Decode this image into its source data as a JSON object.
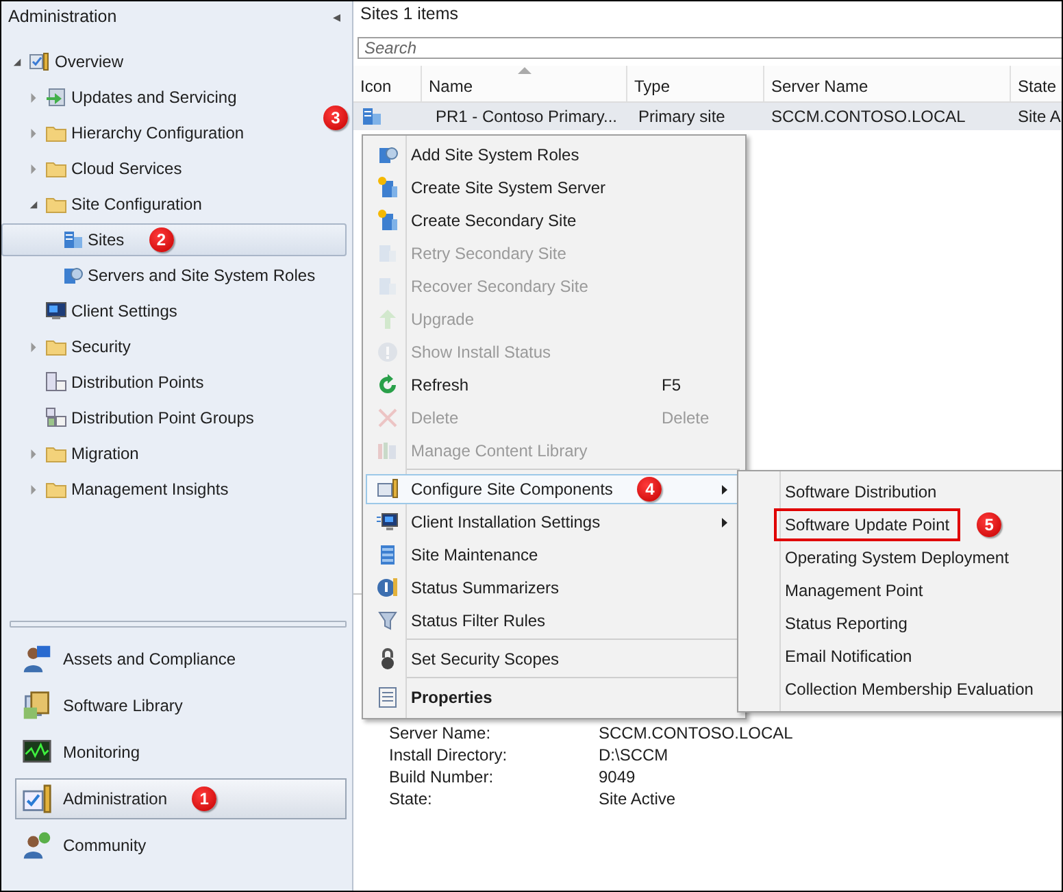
{
  "navigation": {
    "title": "Administration",
    "collapse_glyph": "◂",
    "tree": [
      {
        "label": "Overview",
        "expanded": true,
        "selected": false,
        "children": [
          {
            "label": "Updates and Servicing",
            "expanded": false,
            "selected": false
          },
          {
            "label": "Hierarchy Configuration",
            "expanded": false,
            "selected": false
          },
          {
            "label": "Cloud Services",
            "expanded": false,
            "selected": false
          },
          {
            "label": "Site Configuration",
            "expanded": true,
            "selected": false,
            "children": [
              {
                "label": "Sites",
                "selected": true,
                "callout": "2"
              },
              {
                "label": "Servers and Site System Roles",
                "selected": false
              }
            ]
          },
          {
            "label": "Client Settings",
            "selected": false
          },
          {
            "label": "Security",
            "expanded": false,
            "selected": false
          },
          {
            "label": "Distribution Points",
            "selected": false
          },
          {
            "label": "Distribution Point Groups",
            "selected": false
          },
          {
            "label": "Migration",
            "expanded": false,
            "selected": false
          },
          {
            "label": "Management Insights",
            "expanded": false,
            "selected": false
          }
        ]
      }
    ],
    "workspaces": [
      {
        "label": "Assets and Compliance",
        "selected": false
      },
      {
        "label": "Software Library",
        "selected": false
      },
      {
        "label": "Monitoring",
        "selected": false
      },
      {
        "label": "Administration",
        "selected": true,
        "callout": "1"
      },
      {
        "label": "Community",
        "selected": false
      }
    ]
  },
  "list": {
    "title": "Sites 1 items",
    "search": {
      "placeholder": "Search"
    },
    "columns": [
      {
        "label": "Icon",
        "sorted": false
      },
      {
        "label": "Name",
        "sorted": true
      },
      {
        "label": "Type",
        "sorted": false
      },
      {
        "label": "Server Name",
        "sorted": false
      },
      {
        "label": "State",
        "sorted": false
      }
    ],
    "rows": [
      {
        "selected": true,
        "callout": "3",
        "cells": [
          "",
          "PR1 - Contoso Primary...",
          "Primary site",
          "SCCM.CONTOSO.LOCAL",
          "Site A"
        ]
      }
    ]
  },
  "details": [
    {
      "label": "Server Name:",
      "value": "SCCM.CONTOSO.LOCAL"
    },
    {
      "label": "Install Directory:",
      "value": "D:\\SCCM"
    },
    {
      "label": "Build Number:",
      "value": "9049"
    },
    {
      "label": "State:",
      "value": "Site Active"
    }
  ],
  "context_menu": [
    {
      "kind": "item",
      "label": "Add Site System Roles",
      "disabled": false,
      "highlighted": false,
      "submenu": false,
      "default": false
    },
    {
      "kind": "item",
      "label": "Create Site System Server",
      "disabled": false,
      "highlighted": false,
      "submenu": false,
      "default": false
    },
    {
      "kind": "item",
      "label": "Create Secondary Site",
      "disabled": false,
      "highlighted": false,
      "submenu": false,
      "default": false
    },
    {
      "kind": "item",
      "label": "Retry Secondary Site",
      "disabled": true,
      "highlighted": false,
      "submenu": false,
      "default": false
    },
    {
      "kind": "item",
      "label": "Recover Secondary Site",
      "disabled": true,
      "highlighted": false,
      "submenu": false,
      "default": false
    },
    {
      "kind": "item",
      "label": "Upgrade",
      "disabled": true,
      "highlighted": false,
      "submenu": false,
      "default": false
    },
    {
      "kind": "item",
      "label": "Show Install Status",
      "disabled": true,
      "highlighted": false,
      "submenu": false,
      "default": false
    },
    {
      "kind": "item",
      "label": "Refresh",
      "shortcut": "F5",
      "disabled": false,
      "highlighted": false,
      "submenu": false,
      "default": false
    },
    {
      "kind": "item",
      "label": "Delete",
      "shortcut": "Delete",
      "disabled": true,
      "highlighted": false,
      "submenu": false,
      "default": false
    },
    {
      "kind": "item",
      "label": "Manage Content Library",
      "disabled": true,
      "highlighted": false,
      "submenu": false,
      "default": false
    },
    {
      "kind": "separator"
    },
    {
      "kind": "item",
      "label": "Configure Site Components",
      "disabled": false,
      "highlighted": true,
      "submenu": true,
      "default": false,
      "callout": "4"
    },
    {
      "kind": "item",
      "label": "Client Installation Settings",
      "disabled": false,
      "highlighted": false,
      "submenu": true,
      "default": false
    },
    {
      "kind": "item",
      "label": "Site Maintenance",
      "disabled": false,
      "highlighted": false,
      "submenu": false,
      "default": false
    },
    {
      "kind": "item",
      "label": "Status Summarizers",
      "disabled": false,
      "highlighted": false,
      "submenu": false,
      "default": false
    },
    {
      "kind": "item",
      "label": "Status Filter Rules",
      "disabled": false,
      "highlighted": false,
      "submenu": false,
      "default": false
    },
    {
      "kind": "separator"
    },
    {
      "kind": "item",
      "label": "Set Security Scopes",
      "disabled": false,
      "highlighted": false,
      "submenu": false,
      "default": false
    },
    {
      "kind": "separator"
    },
    {
      "kind": "item",
      "label": "Properties",
      "disabled": false,
      "highlighted": false,
      "submenu": false,
      "default": true
    }
  ],
  "submenu": [
    {
      "label": "Software Distribution",
      "outlined": false
    },
    {
      "label": "Software Update Point",
      "outlined": true,
      "callout": "5"
    },
    {
      "label": "Operating System Deployment",
      "outlined": false
    },
    {
      "label": "Management Point",
      "outlined": false
    },
    {
      "label": "Status Reporting",
      "outlined": false
    },
    {
      "label": "Email Notification",
      "outlined": false
    },
    {
      "label": "Collection Membership Evaluation",
      "outlined": false
    }
  ]
}
